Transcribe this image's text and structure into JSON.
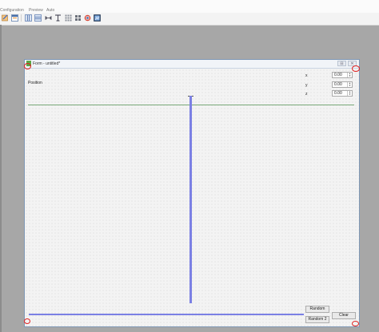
{
  "menubar": {
    "items": [
      "Configuration",
      "Preview",
      "Auto"
    ]
  },
  "toolbar": {
    "icons": [
      "edit-icon",
      "form-icon",
      "layout-vertical-icon",
      "layout-horizontal-icon",
      "splitter-icon",
      "text-icon",
      "grid-icon",
      "grid-small-icon",
      "widget-icon",
      "preview-icon"
    ]
  },
  "form": {
    "title": "Form - untitled*",
    "position_label": "Position",
    "fields": [
      {
        "label": "x",
        "value": "0.00"
      },
      {
        "label": "y",
        "value": "0.00"
      },
      {
        "label": "z",
        "value": "0.00"
      }
    ],
    "buttons": {
      "random": "Random",
      "clear": "Clear",
      "random2": "Random 2"
    }
  },
  "colors": {
    "accent_line": "#7b80e4",
    "annotation_red": "#e02020"
  }
}
